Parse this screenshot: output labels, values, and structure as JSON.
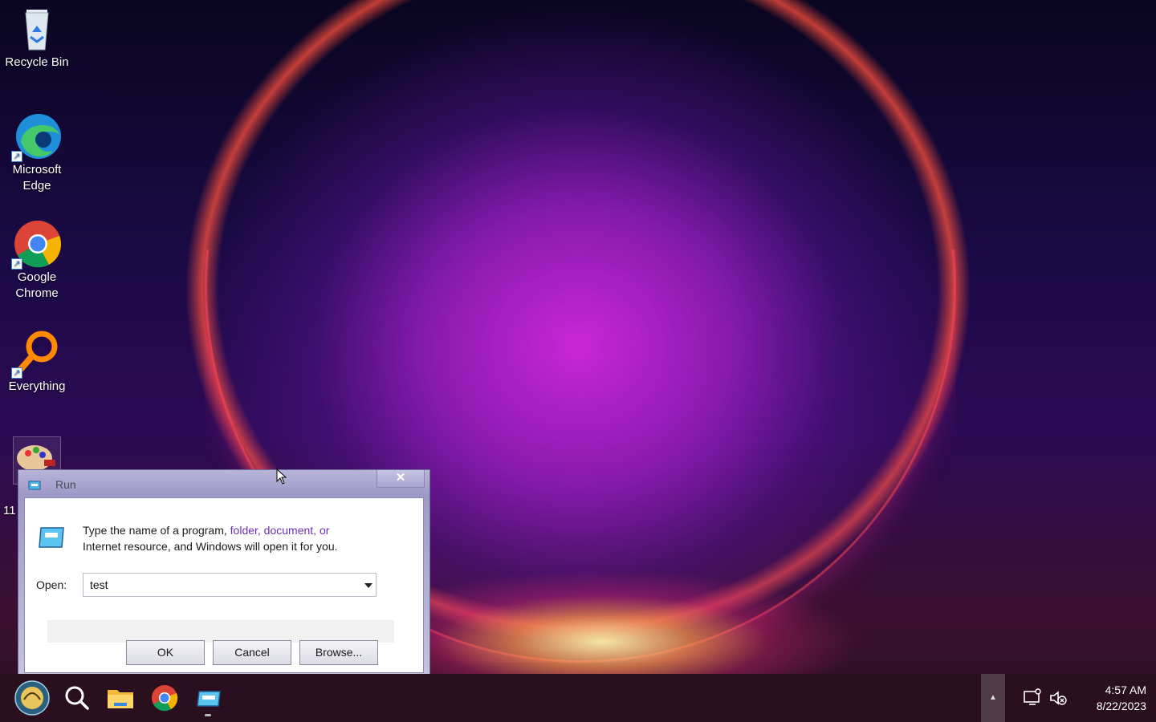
{
  "desktop": {
    "icons": [
      {
        "label": "Recycle Bin",
        "icon": "recycle-bin-icon"
      },
      {
        "label": "Microsoft Edge",
        "icon": "edge-icon"
      },
      {
        "label": "Google Chrome",
        "icon": "chrome-icon"
      },
      {
        "label": "Everything",
        "icon": "everything-search-icon"
      },
      {
        "label": "11",
        "icon": "paint-palette-icon"
      }
    ]
  },
  "run_dialog": {
    "title": "Run",
    "close_glyph": "✕",
    "description_start": "Type the name of a program, ",
    "description_links": "folder, document, or",
    "description_end": "Internet resource, and Windows will open it for you.",
    "open_label": "Open:",
    "open_value": "test",
    "ok_label": "OK",
    "cancel_label": "Cancel",
    "browse_label": "Browse..."
  },
  "taskbar": {
    "items": [
      "start-button",
      "search-icon",
      "file-explorer-icon",
      "chrome-icon",
      "run-icon"
    ],
    "clock_time": "4:57 AM",
    "clock_date": "8/22/2023",
    "tray_expand_glyph": "▲"
  },
  "colors": {
    "taskbar_bg": "#2a0f1e",
    "link": "#6a2fb4"
  }
}
